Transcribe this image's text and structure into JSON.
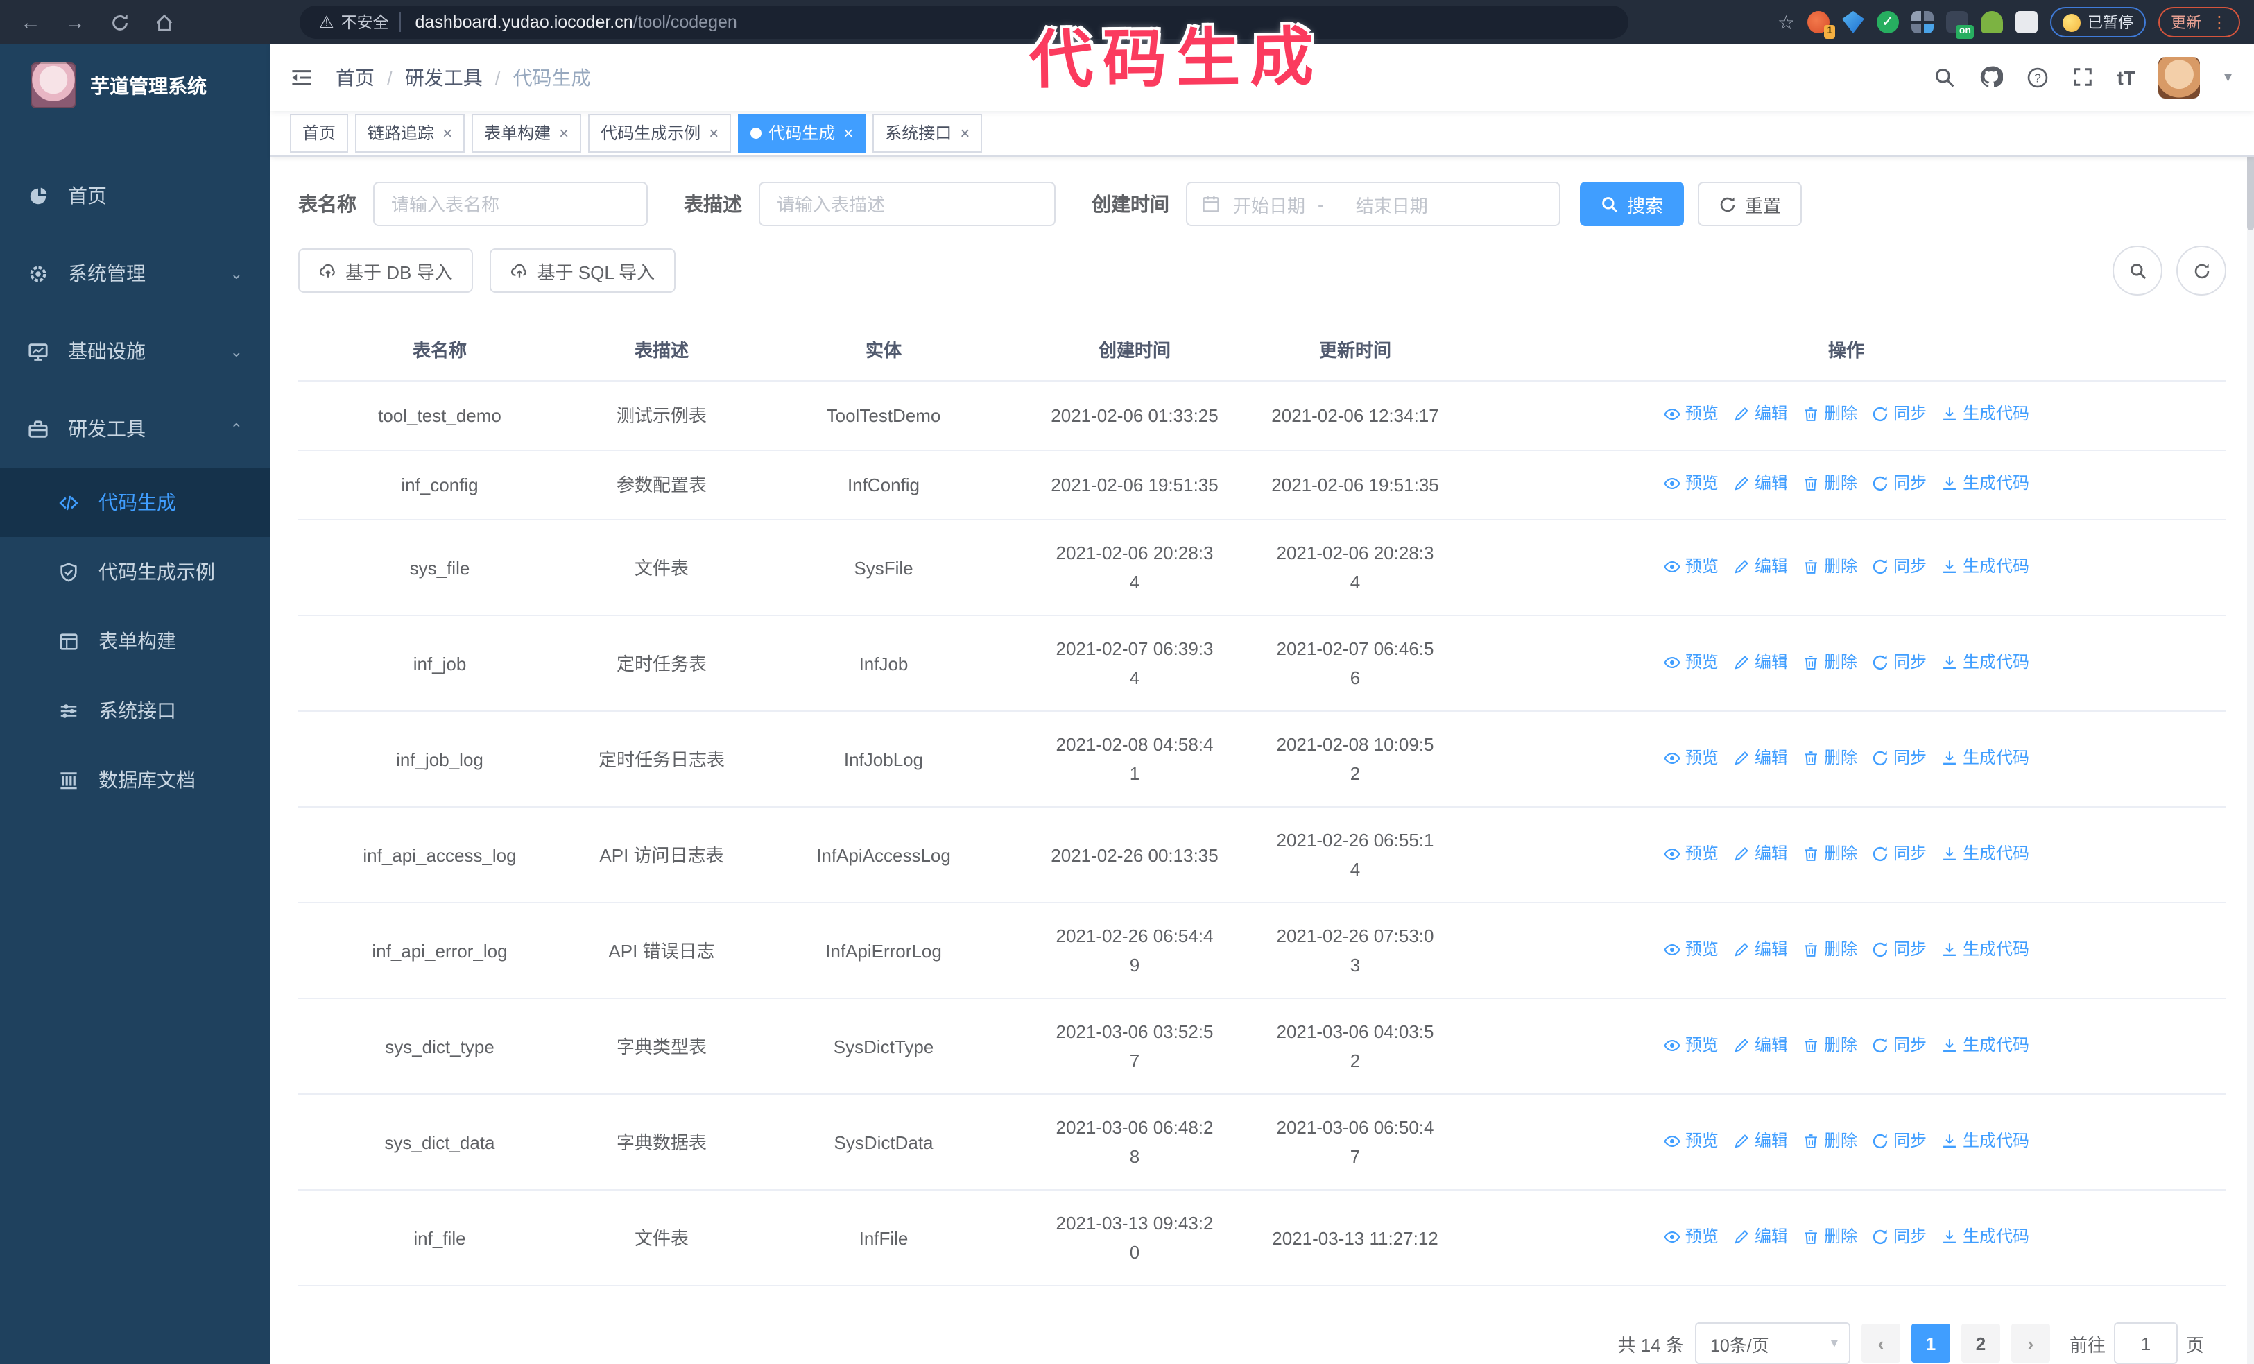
{
  "annotation": {
    "text": "代码生成",
    "color": "#fb3b5e"
  },
  "browser": {
    "insecure_label": "不安全",
    "url_host": "dashboard.yudao.iocoder.cn",
    "url_path": "/tool/codegen",
    "paused_label": "已暂停",
    "update_label": "更新",
    "extension_badge": "1",
    "extension_on_badge": "on"
  },
  "sidebar": {
    "title": "芋道管理系统",
    "items": [
      {
        "label": "首页",
        "icon": "dashboard-icon",
        "type": "top",
        "arrow": ""
      },
      {
        "label": "系统管理",
        "icon": "gear-icon",
        "type": "top",
        "arrow": "down"
      },
      {
        "label": "基础设施",
        "icon": "monitor-icon",
        "type": "top",
        "arrow": "down"
      },
      {
        "label": "研发工具",
        "icon": "toolbox-icon",
        "type": "top",
        "arrow": "up"
      },
      {
        "label": "代码生成",
        "icon": "code-icon",
        "type": "sub",
        "active": true
      },
      {
        "label": "代码生成示例",
        "icon": "shield-check-icon",
        "type": "sub"
      },
      {
        "label": "表单构建",
        "icon": "form-icon",
        "type": "sub"
      },
      {
        "label": "系统接口",
        "icon": "sliders-icon",
        "type": "sub"
      },
      {
        "label": "数据库文档",
        "icon": "database-icon",
        "type": "sub"
      }
    ]
  },
  "navbar": {
    "breadcrumb": [
      "首页",
      "研发工具",
      "代码生成"
    ],
    "right_icons": [
      "search-icon",
      "github-icon",
      "help-icon",
      "fullscreen-icon",
      "font-size-icon",
      "avatar",
      "caret-down-icon"
    ],
    "font_size_glyph": "tT"
  },
  "tabs": {
    "items": [
      {
        "label": "首页",
        "closable": false,
        "active": false
      },
      {
        "label": "链路追踪",
        "closable": true,
        "active": false
      },
      {
        "label": "表单构建",
        "closable": true,
        "active": false
      },
      {
        "label": "代码生成示例",
        "closable": true,
        "active": false
      },
      {
        "label": "代码生成",
        "closable": true,
        "active": true
      },
      {
        "label": "系统接口",
        "closable": true,
        "active": false
      }
    ]
  },
  "filters": {
    "name_label": "表名称",
    "name_placeholder": "请输入表名称",
    "desc_label": "表描述",
    "desc_placeholder": "请输入表描述",
    "time_label": "创建时间",
    "start_placeholder": "开始日期",
    "range_separator": "-",
    "end_placeholder": "结束日期",
    "search_label": "搜索",
    "reset_label": "重置"
  },
  "toolbar": {
    "import_db_label": "基于 DB 导入",
    "import_sql_label": "基于 SQL 导入"
  },
  "table": {
    "columns": [
      "表名称",
      "表描述",
      "实体",
      "创建时间",
      "更新时间",
      "操作"
    ],
    "actions": [
      {
        "label": "预览",
        "icon": "eye-icon"
      },
      {
        "label": "编辑",
        "icon": "edit-icon"
      },
      {
        "label": "删除",
        "icon": "delete-icon"
      },
      {
        "label": "同步",
        "icon": "sync-icon"
      },
      {
        "label": "生成代码",
        "icon": "download-icon"
      }
    ],
    "rows": [
      {
        "name": "tool_test_demo",
        "desc": "测试示例表",
        "entity": "ToolTestDemo",
        "created": "2021-02-06 01:33:25",
        "updated": "2021-02-06 12:34:17"
      },
      {
        "name": "inf_config",
        "desc": "参数配置表",
        "entity": "InfConfig",
        "created": "2021-02-06 19:51:35",
        "updated": "2021-02-06 19:51:35"
      },
      {
        "name": "sys_file",
        "desc": "文件表",
        "entity": "SysFile",
        "created": "2021-02-06 20:28:3\n4",
        "updated": "2021-02-06 20:28:3\n4"
      },
      {
        "name": "inf_job",
        "desc": "定时任务表",
        "entity": "InfJob",
        "created": "2021-02-07 06:39:3\n4",
        "updated": "2021-02-07 06:46:5\n6"
      },
      {
        "name": "inf_job_log",
        "desc": "定时任务日志表",
        "entity": "InfJobLog",
        "created": "2021-02-08 04:58:4\n1",
        "updated": "2021-02-08 10:09:5\n2"
      },
      {
        "name": "inf_api_access_log",
        "desc": "API 访问日志表",
        "entity": "InfApiAccessLog",
        "created": "2021-02-26 00:13:35",
        "updated": "2021-02-26 06:55:1\n4"
      },
      {
        "name": "inf_api_error_log",
        "desc": "API 错误日志",
        "entity": "InfApiErrorLog",
        "created": "2021-02-26 06:54:4\n9",
        "updated": "2021-02-26 07:53:0\n3"
      },
      {
        "name": "sys_dict_type",
        "desc": "字典类型表",
        "entity": "SysDictType",
        "created": "2021-03-06 03:52:5\n7",
        "updated": "2021-03-06 04:03:5\n2"
      },
      {
        "name": "sys_dict_data",
        "desc": "字典数据表",
        "entity": "SysDictData",
        "created": "2021-03-06 06:48:2\n8",
        "updated": "2021-03-06 06:50:4\n7"
      },
      {
        "name": "inf_file",
        "desc": "文件表",
        "entity": "InfFile",
        "created": "2021-03-13 09:43:2\n0",
        "updated": "2021-03-13 11:27:12"
      }
    ]
  },
  "pagination": {
    "total_label": "共 14 条",
    "page_size_label": "10条/页",
    "pages": [
      "1",
      "2"
    ],
    "active_page": "1",
    "goto_label": "前往",
    "goto_value": "1",
    "page_unit": "页"
  },
  "colors": {
    "accent": "#409EFF",
    "sidebar_bg": "#1f415e",
    "annotation_pink": "#fb3b5e"
  }
}
